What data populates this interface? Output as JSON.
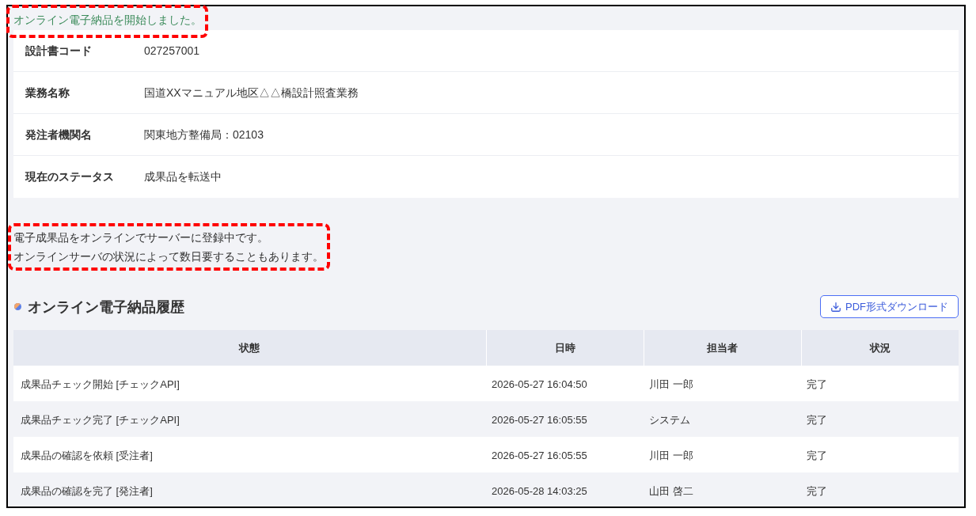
{
  "notice": {
    "text": "オンライン電子納品を開始しました。",
    "highlighted": true
  },
  "details": [
    {
      "label": "設計書コード",
      "value": "027257001"
    },
    {
      "label": "業務名称",
      "value": "国道XXマニュアル地区△△橋設計照査業務"
    },
    {
      "label": "発注者機関名",
      "value": "関東地方整備局：02103"
    },
    {
      "label": "現在のステータス",
      "value": "成果品を転送中"
    }
  ],
  "message": {
    "lines": [
      "電子成果品をオンラインでサーバーに登録中です。",
      "オンラインサーバの状況によって数日要することもあります。"
    ],
    "highlighted": true
  },
  "history": {
    "title": "オンライン電子納品履歴",
    "download_button": "PDF形式ダウンロード",
    "columns": [
      "状態",
      "日時",
      "担当者",
      "状況"
    ],
    "rows": [
      [
        "成果品チェック開始 [チェックAPI]",
        "2026-05-27 16:04:50",
        "川田 一郎",
        "完了"
      ],
      [
        "成果品チェック完了 [チェックAPI]",
        "2026-05-27 16:05:55",
        "システム",
        "完了"
      ],
      [
        "成果品の確認を依頼 [受注者]",
        "2026-05-27 16:05:55",
        "川田 一郎",
        "完了"
      ],
      [
        "成果品の確認を完了 [発注者]",
        "2026-05-28 14:03:25",
        "山田 啓二",
        "完了"
      ]
    ]
  }
}
